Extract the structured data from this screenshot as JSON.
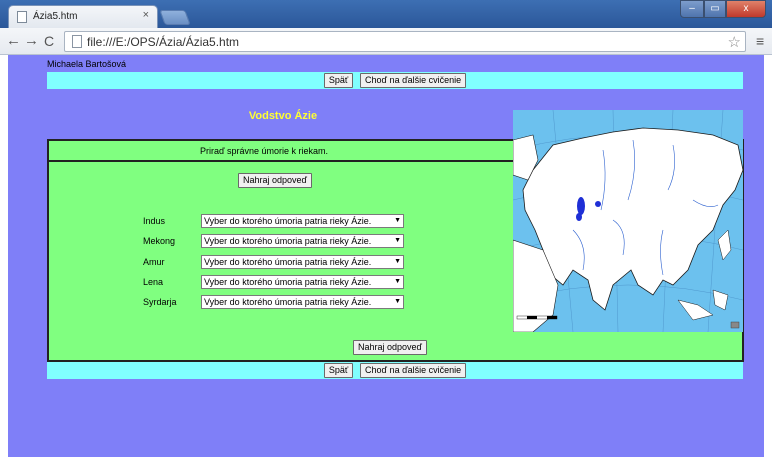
{
  "browser": {
    "tab_title": "Ázia5.htm",
    "tab_close": "×",
    "url": "file:///E:/OPS/Ázia/Ázia5.htm",
    "back_icon": "←",
    "forward_icon": "→",
    "reload_icon": "C",
    "star_icon": "☆",
    "menu_icon": "≡",
    "win_min": "‒",
    "win_max": "▭",
    "win_close": "x"
  },
  "page": {
    "author": "Michaela Bartošová",
    "nav_top": {
      "back": "Späť",
      "next": "Choď na ďalšie cvičenie"
    },
    "nav_bottom": {
      "back": "Späť",
      "next": "Choď na ďalšie cvičenie"
    },
    "title": "Vodstvo Ázie",
    "instruction": "Priraď správne úmorie k riekam.",
    "submit_top": "Nahraj odpoveď",
    "submit_bottom": "Nahraj odpoveď",
    "rivers": [
      {
        "label": "Indus",
        "select": "Vyber do ktorého úmoria patria rieky Ázie."
      },
      {
        "label": "Mekong",
        "select": "Vyber do ktorého úmoria patria rieky Ázie."
      },
      {
        "label": "Amur",
        "select": "Vyber do ktorého úmoria patria rieky Ázie."
      },
      {
        "label": "Lena",
        "select": "Vyber do ktorého úmoria patria rieky Ázie."
      },
      {
        "label": "Syrdarja",
        "select": "Vyber do ktorého úmoria patria rieky Ázie."
      }
    ]
  },
  "colors": {
    "page_bg": "#7f7ff8",
    "navbar_bg": "#80ffff",
    "panel_bg": "#80ff80",
    "title": "#ffff33",
    "map_water": "#6cc1ee"
  }
}
